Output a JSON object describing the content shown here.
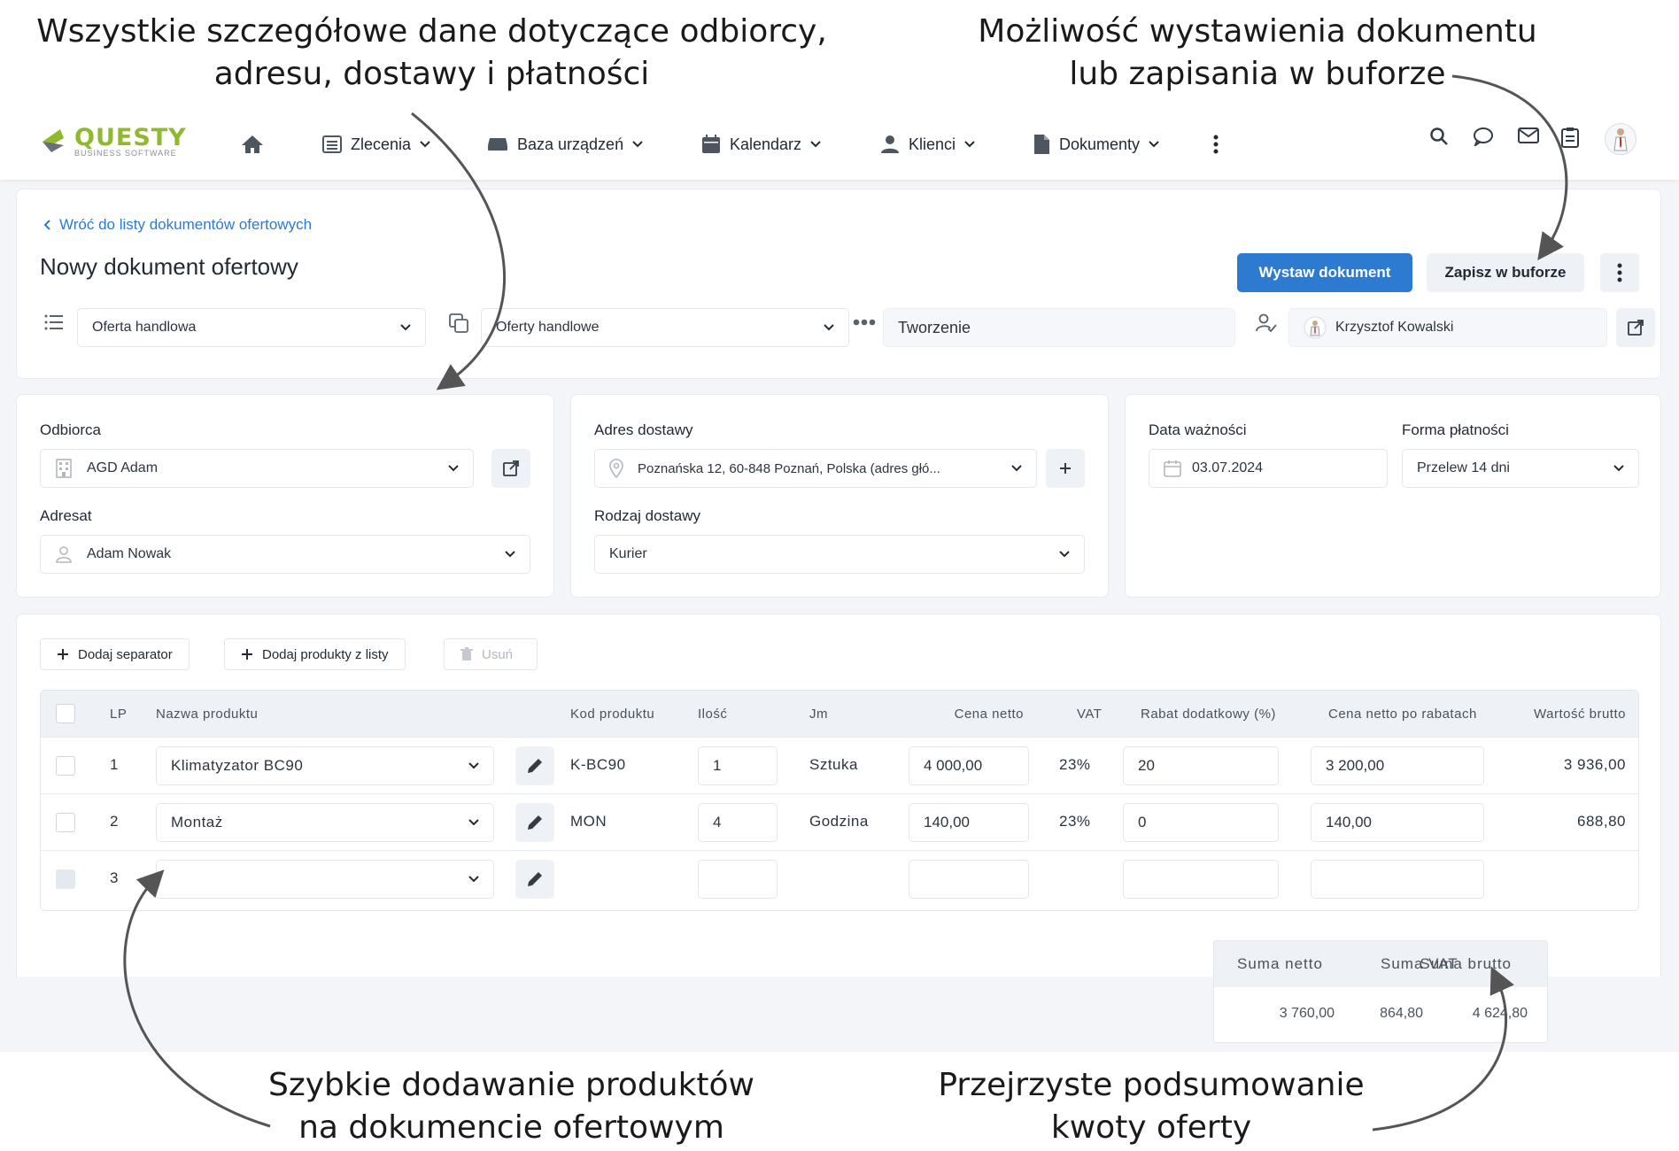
{
  "annotations": {
    "top_left_line1": "Wszystkie szczegółowe dane dotyczące odbiorcy,",
    "top_left_line2": "adresu, dostawy i płatności",
    "top_right_line1": "Możliwość wystawienia dokumentu",
    "top_right_line2": "lub zapisania w buforze",
    "bottom_left_line1": "Szybkie dodawanie produktów",
    "bottom_left_line2": "na dokumencie ofertowym",
    "bottom_right_line1": "Przejrzyste podsumowanie",
    "bottom_right_line2": "kwoty oferty"
  },
  "app": {
    "logo_name": "QUESTY",
    "logo_sub": "BUSINESS SOFTWARE",
    "accent": "#2d7bd1",
    "logo_color": "#8fb92f"
  },
  "nav": {
    "home_icon": "home-icon",
    "items": [
      {
        "label": "Zlecenia",
        "icon": "list-icon"
      },
      {
        "label": "Baza urządzeń",
        "icon": "device-icon"
      },
      {
        "label": "Kalendarz",
        "icon": "calendar-icon"
      },
      {
        "label": "Klienci",
        "icon": "person-icon"
      },
      {
        "label": "Dokumenty",
        "icon": "document-icon"
      }
    ],
    "right_icons": [
      "search-icon",
      "chat-icon",
      "mail-icon",
      "clipboard-icon",
      "avatar"
    ]
  },
  "header": {
    "back_link": "Wróć do listy dokumentów ofertowych",
    "title": "Nowy dokument ofertowy",
    "issue_button": "Wystaw dokument",
    "buffer_button": "Zapisz w buforze",
    "doc_type": "Oferta handlowa",
    "doc_series": "Oferty handlowe",
    "status": "Tworzenie",
    "owner": "Krzysztof Kowalski"
  },
  "recipient": {
    "recipient_label": "Odbiorca",
    "recipient_value": "AGD Adam",
    "addressee_label": "Adresat",
    "addressee_value": "Adam Nowak"
  },
  "delivery": {
    "address_label": "Adres dostawy",
    "address_value": "Poznańska 12, 60-848 Poznań, Polska (adres głó...",
    "type_label": "Rodzaj dostawy",
    "type_value": "Kurier"
  },
  "payment": {
    "validity_label": "Data ważności",
    "validity_value": "03.07.2024",
    "method_label": "Forma płatności",
    "method_value": "Przelew 14 dni"
  },
  "toolbar": {
    "add_separator": "Dodaj separator",
    "add_products": "Dodaj produkty z listy",
    "delete": "Usuń"
  },
  "table": {
    "headers": {
      "lp": "LP",
      "name": "Nazwa produktu",
      "code": "Kod produktu",
      "qty": "Ilość",
      "unit": "Jm",
      "net_price": "Cena netto",
      "vat": "VAT",
      "discount": "Rabat dodatkowy (%)",
      "net_after": "Cena netto po rabatach",
      "gross": "Wartość brutto"
    },
    "rows": [
      {
        "lp": "1",
        "name": "Klimatyzator BC90",
        "code": "K-BC90",
        "qty": "1",
        "unit": "Sztuka",
        "net_price": "4 000,00",
        "vat": "23%",
        "discount": "20",
        "net_after": "3 200,00",
        "gross": "3 936,00"
      },
      {
        "lp": "2",
        "name": "Montaż",
        "code": "MON",
        "qty": "4",
        "unit": "Godzina",
        "net_price": "140,00",
        "vat": "23%",
        "discount": "0",
        "net_after": "140,00",
        "gross": "688,80"
      },
      {
        "lp": "3",
        "name": "",
        "code": "",
        "qty": "",
        "unit": "",
        "net_price": "",
        "vat": "",
        "discount": "",
        "net_after": "",
        "gross": ""
      }
    ]
  },
  "summary": {
    "net_label": "Suma netto",
    "vat_label": "Suma VAT",
    "gross_label": "Suma brutto",
    "net_value": "3 760,00",
    "vat_value": "864,80",
    "gross_value": "4 624,80"
  }
}
